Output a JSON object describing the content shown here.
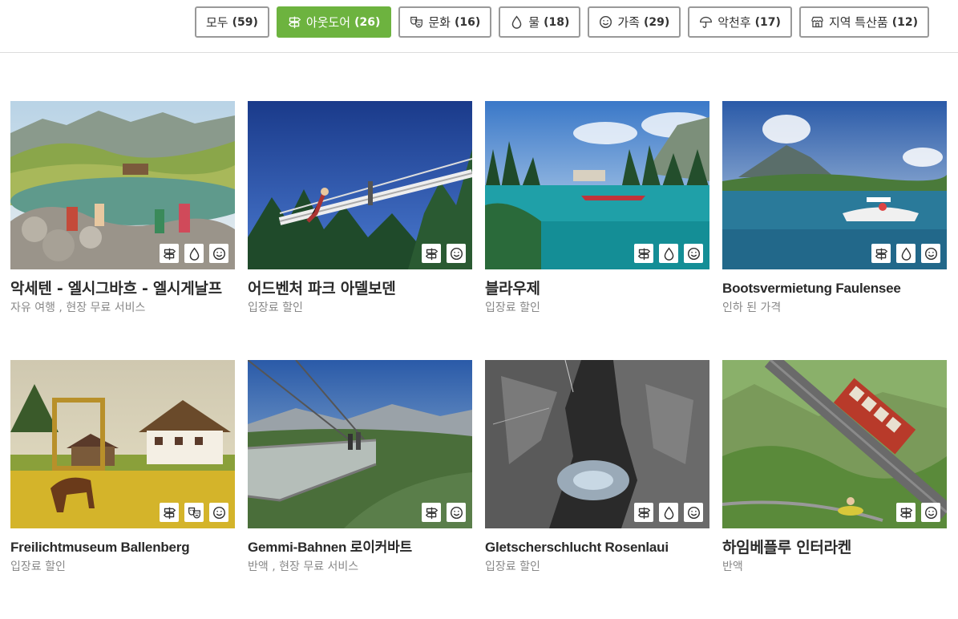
{
  "filters": [
    {
      "label": "모두",
      "count": "(59)",
      "icon": "",
      "active": false
    },
    {
      "label": "아웃도어",
      "count": "(26)",
      "icon": "signpost-icon",
      "active": true
    },
    {
      "label": "문화",
      "count": "(16)",
      "icon": "theater-masks-icon",
      "active": false
    },
    {
      "label": "물",
      "count": "(18)",
      "icon": "water-drop-icon",
      "active": false
    },
    {
      "label": "가족",
      "count": "(29)",
      "icon": "smiley-icon",
      "active": false
    },
    {
      "label": "악천후",
      "count": "(17)",
      "icon": "umbrella-icon",
      "active": false
    },
    {
      "label": "지역 특산품",
      "count": "(12)",
      "icon": "shop-icon",
      "active": false
    }
  ],
  "cards": [
    {
      "title": "악세텐 - 엘시그바흐 - 엘시게날프",
      "subtitle": "자유 여행 , 현장 무료 서비스",
      "scene": "alpine-lake",
      "icons": [
        "signpost-icon",
        "water-drop-icon",
        "smiley-icon"
      ]
    },
    {
      "title": "어드벤처 파크 아델보덴",
      "subtitle": "입장료 할인",
      "scene": "ropes-park",
      "icons": [
        "signpost-icon",
        "smiley-icon"
      ]
    },
    {
      "title": "블라우제",
      "subtitle": "입장료 할인",
      "scene": "blue-lake",
      "icons": [
        "signpost-icon",
        "water-drop-icon",
        "smiley-icon"
      ]
    },
    {
      "title": "Bootsvermietung Faulensee",
      "subtitle": "인하 된 가격",
      "scene": "boat-lake",
      "icons": [
        "signpost-icon",
        "water-drop-icon",
        "smiley-icon"
      ]
    },
    {
      "title": "Freilichtmuseum Ballenberg",
      "subtitle": "입장료 할인",
      "scene": "museum-farm",
      "icons": [
        "signpost-icon",
        "theater-masks-icon",
        "smiley-icon"
      ]
    },
    {
      "title": "Gemmi-Bahnen 로이커바트",
      "subtitle": "반액 , 현장 무료 서비스",
      "scene": "skywalk",
      "icons": [
        "signpost-icon",
        "smiley-icon"
      ]
    },
    {
      "title": "Gletscherschlucht Rosenlaui",
      "subtitle": "입장료 할인",
      "scene": "gorge",
      "icons": [
        "signpost-icon",
        "water-drop-icon",
        "smiley-icon"
      ]
    },
    {
      "title": "하임베플루 인터라켄",
      "subtitle": "반액",
      "scene": "funicular",
      "icons": [
        "signpost-icon",
        "smiley-icon"
      ]
    }
  ],
  "colors": {
    "accent": "#6db33f",
    "text": "#2a2a2a",
    "muted": "#888888",
    "border": "#999999"
  }
}
